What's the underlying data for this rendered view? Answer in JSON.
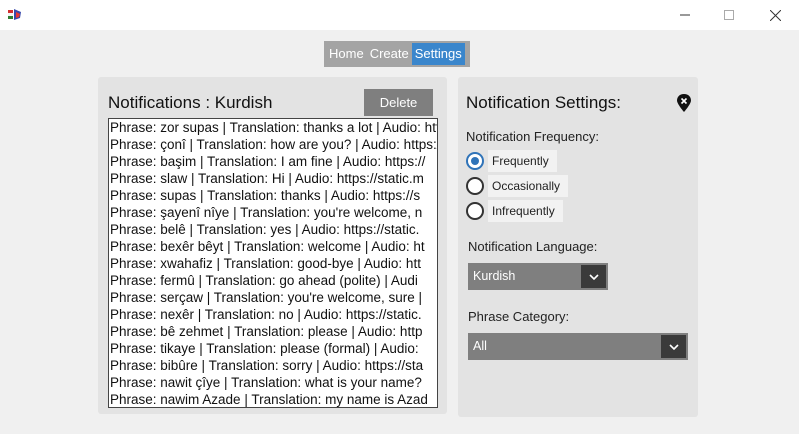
{
  "window": {
    "icon": "app-flag-icon",
    "controls": [
      "minimize-icon",
      "maximize-icon",
      "close-icon"
    ]
  },
  "nav": {
    "items": [
      "Home",
      "Create",
      "Settings"
    ],
    "active": "Settings",
    "accent": "#3a86cc"
  },
  "notifications": {
    "title": "Notifications : Kurdish",
    "delete_label": "Delete",
    "items": [
      "Phrase: zor supas | Translation: thanks a lot | Audio: https://",
      "Phrase: çonî | Translation: how are you? | Audio: https://",
      "Phrase: başim | Translation: I am fine | Audio: https://",
      "Phrase: slaw | Translation: Hi | Audio: https://static.m",
      "Phrase: supas | Translation: thanks | Audio: https://s",
      "Phrase: şayenî nîye | Translation: you're welcome, n",
      "Phrase: belê | Translation: yes | Audio: https://static.",
      "Phrase: bexêr bêyt | Translation: welcome | Audio: ht",
      "Phrase: xwahafiz | Translation: good-bye | Audio: htt",
      "Phrase: fermû | Translation: go ahead (polite) | Audi",
      "Phrase: serçaw | Translation: you're welcome, sure |",
      "Phrase: nexêr | Translation: no | Audio: https://static.",
      "Phrase: bê zehmet | Translation: please | Audio: http",
      "Phrase: tikaye | Translation: please (formal) | Audio:",
      "Phrase: bibûre | Translation: sorry | Audio: https://sta",
      "Phrase: nawit çîye | Translation: what is your name?",
      "Phrase: nawim Azade | Translation: my name is Azad"
    ]
  },
  "settings": {
    "title": "Notification Settings:",
    "pin_icon": "pin-icon",
    "frequency_label": "Notification Frequency:",
    "frequency_options": [
      "Frequently",
      "Occasionally",
      "Infrequently"
    ],
    "frequency_selected": "Frequently",
    "language_label": "Notification Language:",
    "language_value": "Kurdish",
    "category_label": "Phrase Category:",
    "category_value": "All"
  }
}
